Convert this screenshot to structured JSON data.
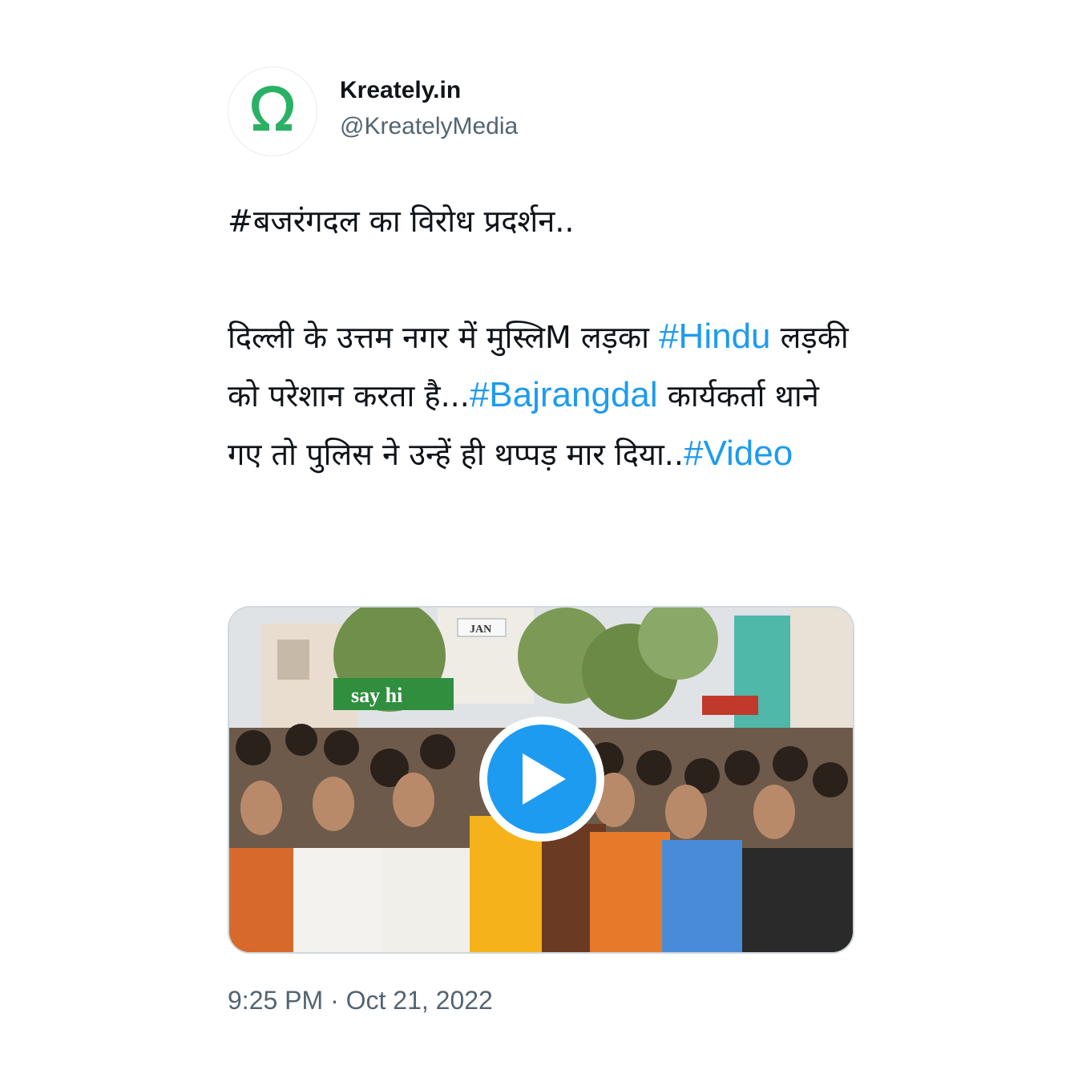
{
  "account": {
    "display_name": "Kreately.in",
    "handle": "@KreatelyMedia",
    "avatar_icon": "omega-logo-icon",
    "avatar_glyph": "Ω",
    "avatar_color": "#2bb166"
  },
  "tweet": {
    "line1": "#बजरंगदल का विरोध प्रदर्शन..",
    "segments": [
      {
        "text": "दिल्ली के उत्तम नगर में मुस्लिM लड़का ",
        "type": "text"
      },
      {
        "text": "#Hindu",
        "type": "hashtag"
      },
      {
        "text": " लड़की को परेशान करता है...",
        "type": "text"
      },
      {
        "text": "#Bajrangdal",
        "type": "hashtag"
      },
      {
        "text": " कार्यकर्ता थाने गए तो पुलिस ने उन्हें ही थप्पड़ मार दिया..",
        "type": "text"
      },
      {
        "text": "#Video",
        "type": "hashtag"
      }
    ],
    "hashtag_color": "#1d9bf0"
  },
  "media": {
    "type": "video",
    "play_icon": "play-icon",
    "play_button_color": "#1d9bf0",
    "signs": {
      "say_hi": "say hi",
      "jan": "JAN"
    }
  },
  "timestamp": "9:25 PM · Oct 21, 2022"
}
